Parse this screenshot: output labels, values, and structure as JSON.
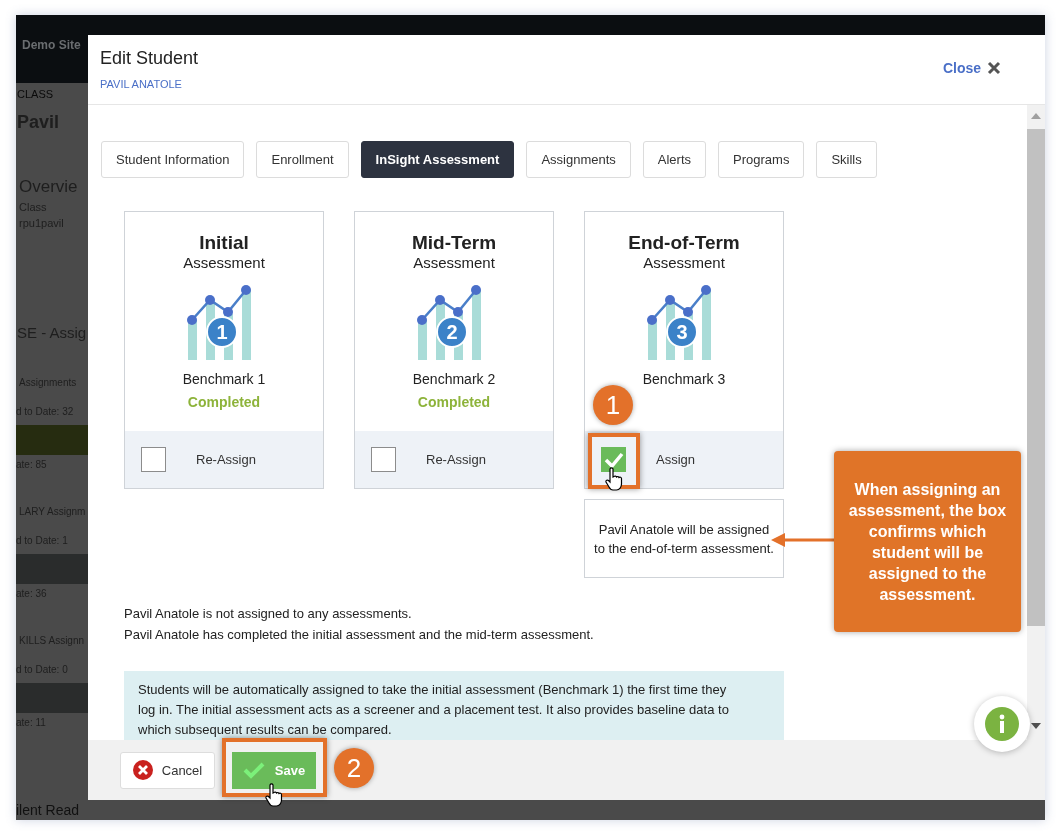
{
  "background_page": {
    "site_title": "Demo Site",
    "breadcrumb": "CLASS",
    "student_name": "Pavil",
    "section_heading": "Overvie",
    "class_label": "Class",
    "username": "rpu1pavil",
    "assignment_heading": "SE - Assig",
    "groups": [
      {
        "title": "Assignments",
        "assigned": "d to Date: 32",
        "color": "#262c10",
        "completed": "ate: 85"
      },
      {
        "title": "LARY Assignm",
        "assigned": "d to Date: 1",
        "color": "#2a2c2c",
        "completed": "ate: 36"
      },
      {
        "title": "KILLS Assignn",
        "assigned": "d to Date: 0",
        "color": "#2a2c2c",
        "completed": "ate: 11"
      }
    ],
    "footer_heading": "ilent Read"
  },
  "modal": {
    "title": "Edit Student",
    "subtitle": "PAVIL ANATOLE",
    "close_label": "Close",
    "tabs": [
      {
        "label": "Student Information",
        "selected": false
      },
      {
        "label": "Enrollment",
        "selected": false
      },
      {
        "label": "InSight Assessment",
        "selected": true
      },
      {
        "label": "Assignments",
        "selected": false
      },
      {
        "label": "Alerts",
        "selected": false
      },
      {
        "label": "Programs",
        "selected": false
      },
      {
        "label": "Skills",
        "selected": false
      }
    ],
    "assessments": [
      {
        "title": "Initial",
        "subtitle": "Assessment",
        "number": "1",
        "benchmark": "Benchmark 1",
        "status": "Completed",
        "action": "Re-Assign",
        "checked": false
      },
      {
        "title": "Mid-Term",
        "subtitle": "Assessment",
        "number": "2",
        "benchmark": "Benchmark 2",
        "status": "Completed",
        "action": "Re-Assign",
        "checked": false
      },
      {
        "title": "End-of-Term",
        "subtitle": "Assessment",
        "number": "3",
        "benchmark": "Benchmark 3",
        "action": "Assign",
        "checked": true,
        "confirmation": "Pavil Anatole will be assigned to the end-of-term assessment."
      }
    ],
    "status_lines": [
      "Pavil Anatole is not assigned to any assessments.",
      "Pavil Anatole has completed the initial assessment and the mid-term assessment."
    ],
    "info_text": "Students will be automatically assigned to take the initial assessment (Benchmark 1) the first time they log in. The initial assessment acts as a screener and a placement test. It also provides baseline data to which subsequent results can be compared.",
    "buttons": [
      {
        "label": "Cancel",
        "kind": "cancel"
      },
      {
        "label": "Save",
        "kind": "save"
      }
    ]
  },
  "annotations": {
    "steps": [
      "1",
      "2"
    ],
    "callout": "When assigning an assessment, the box confirms which student will be assigned to the assessment."
  }
}
